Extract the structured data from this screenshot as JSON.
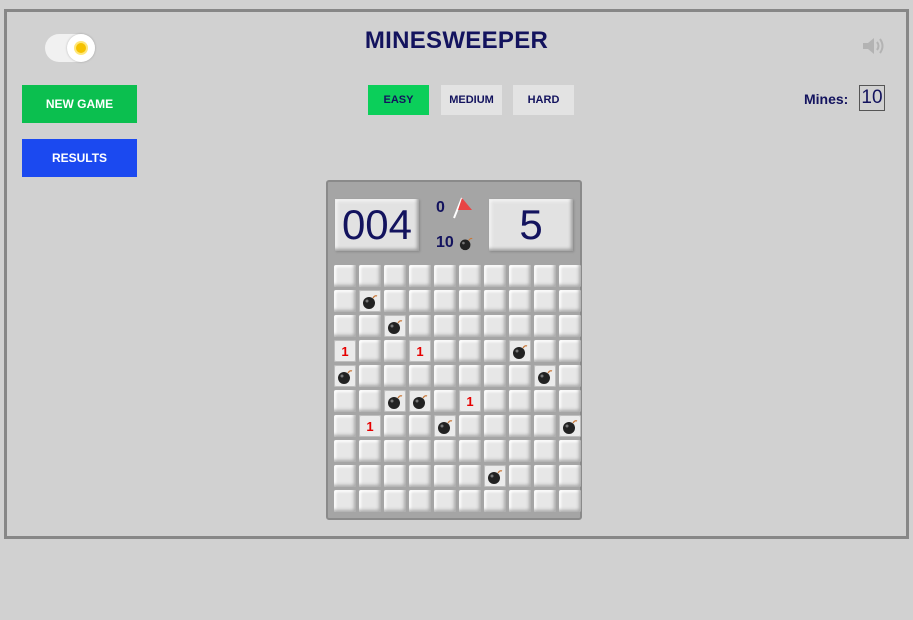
{
  "header": {
    "title": "MINESWEEPER"
  },
  "sidebar": {
    "new_game_label": "NEW GAME",
    "results_label": "RESULTS"
  },
  "difficulty": {
    "options": [
      "EASY",
      "MEDIUM",
      "HARD"
    ],
    "selected": "EASY"
  },
  "mines_setting": {
    "label": "Mines:",
    "value": "10"
  },
  "game": {
    "timer": "004",
    "moves": "5",
    "flags": "0",
    "mines": "10",
    "board": [
      [
        "c",
        "c",
        "c",
        "c",
        "c",
        "c",
        "c",
        "c",
        "c",
        "c"
      ],
      [
        "c",
        "b",
        "c",
        "c",
        "c",
        "c",
        "c",
        "c",
        "c",
        "c"
      ],
      [
        "c",
        "c",
        "b",
        "c",
        "c",
        "c",
        "c",
        "c",
        "c",
        "c"
      ],
      [
        "1",
        "c",
        "c",
        "1",
        "c",
        "c",
        "c",
        "b",
        "c",
        "c"
      ],
      [
        "b",
        "c",
        "c",
        "c",
        "c",
        "c",
        "c",
        "c",
        "b",
        "c"
      ],
      [
        "c",
        "c",
        "b",
        "b",
        "c",
        "1",
        "c",
        "c",
        "c",
        "c"
      ],
      [
        "c",
        "1",
        "c",
        "c",
        "b",
        "c",
        "c",
        "c",
        "c",
        "b"
      ],
      [
        "c",
        "c",
        "c",
        "c",
        "c",
        "c",
        "c",
        "c",
        "c",
        "c"
      ],
      [
        "c",
        "c",
        "c",
        "c",
        "c",
        "c",
        "b",
        "c",
        "c",
        "c"
      ],
      [
        "c",
        "c",
        "c",
        "c",
        "c",
        "c",
        "c",
        "c",
        "c",
        "c"
      ]
    ]
  },
  "icons": {
    "theme_toggle": "sun-icon",
    "sound": "speaker-icon",
    "flag": "flag-icon",
    "mine": "bomb-icon"
  },
  "colors": {
    "background": "#d1d1d1",
    "title": "#13135e",
    "new_game": "#0bbf4f",
    "results": "#1b49f0",
    "easy_selected": "#0bcf5a",
    "number": "#e60000"
  }
}
